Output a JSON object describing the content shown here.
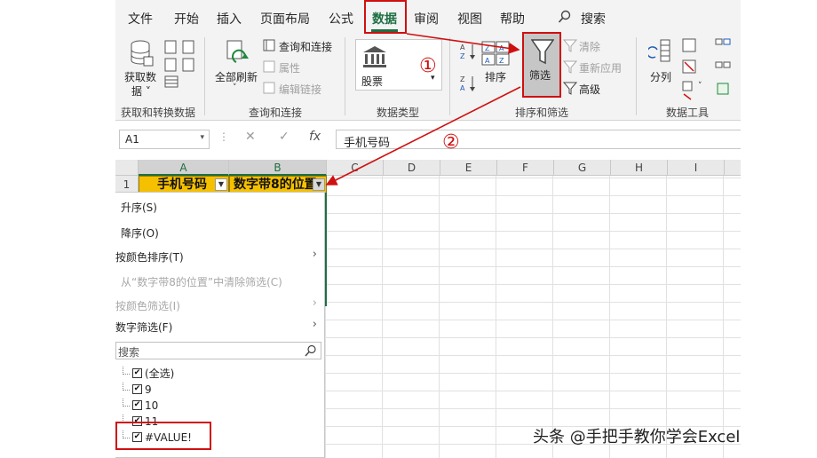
{
  "menu": {
    "items": [
      {
        "label": "文件"
      },
      {
        "label": "开始"
      },
      {
        "label": "插入"
      },
      {
        "label": "页面布局"
      },
      {
        "label": "公式"
      },
      {
        "label": "数据"
      },
      {
        "label": "审阅"
      },
      {
        "label": "视图"
      },
      {
        "label": "帮助"
      }
    ],
    "active": "数据",
    "search_label": "搜索"
  },
  "ribbon": {
    "get_data": {
      "label_line1": "获取数",
      "label_line2": "据 ˅",
      "group": "获取和转换数据"
    },
    "refresh_all": {
      "label": "全部刷新",
      "group": "查询和连接"
    },
    "queries_connections": "查询和连接",
    "properties": "属性",
    "edit_links": "编辑链接",
    "stocks": {
      "label": "股票",
      "group": "数据类型"
    },
    "sort": "排序",
    "filter": "筛选",
    "clear": "清除",
    "reapply": "重新应用",
    "advanced": "高级",
    "sort_filter_group": "排序和筛选",
    "text_to_columns": "分列",
    "data_tools_group": "数据工具"
  },
  "formula_bar": {
    "name_box": "A1",
    "cancel": "✕",
    "enter": "✓",
    "fx": "fx",
    "content": "手机号码"
  },
  "sheet": {
    "columns": [
      "A",
      "B",
      "C",
      "D",
      "E",
      "F",
      "G",
      "H",
      "I"
    ],
    "row1": "1",
    "header_a": "手机号码",
    "header_b": "数字带8的位置"
  },
  "filter_menu": {
    "sort_asc": "升序(S)",
    "sort_desc": "降序(O)",
    "sort_by_color": "按颜色排序(T)",
    "clear_filter": "从“数字带8的位置”中清除筛选(C)",
    "filter_by_color": "按颜色筛选(I)",
    "number_filters": "数字筛选(F)",
    "search_placeholder": "搜索",
    "options": [
      {
        "label": "(全选)",
        "checked": true
      },
      {
        "label": "9",
        "checked": true
      },
      {
        "label": "10",
        "checked": true
      },
      {
        "label": "11",
        "checked": true
      },
      {
        "label": "#VALUE!",
        "checked": true
      }
    ]
  },
  "annotations": {
    "step1": "①",
    "step2": "②",
    "color": "#d01010"
  },
  "watermark": "头条 @手把手教你学会Excel",
  "colors": {
    "accent": "#1d6f42",
    "header_fill": "#f5c000",
    "highlight": "#d01010"
  }
}
